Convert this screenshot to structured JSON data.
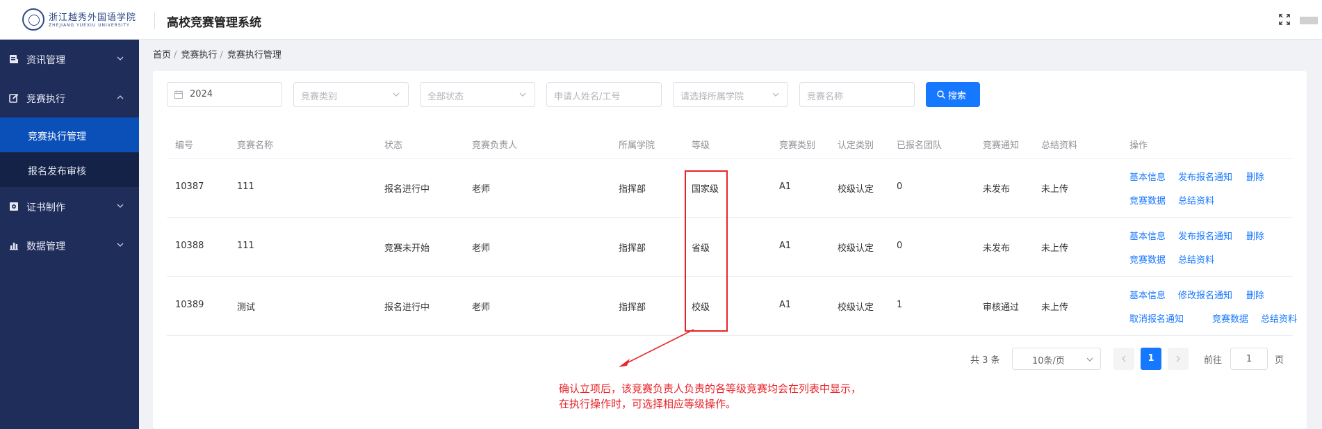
{
  "header": {
    "logo_text": "浙江越秀外国语学院",
    "logo_sub": "ZHEJIANG YUEXIU UNIVERSITY",
    "title": "高校竞赛管理系统"
  },
  "sidebar": {
    "items": [
      {
        "label": "资讯管理",
        "icon": "document-icon"
      },
      {
        "label": "竞赛执行",
        "icon": "edit-icon",
        "expanded": true,
        "children": [
          {
            "label": "竞赛执行管理",
            "active": true
          },
          {
            "label": "报名发布审核"
          }
        ]
      },
      {
        "label": "证书制作",
        "icon": "certificate-icon"
      },
      {
        "label": "数据管理",
        "icon": "bar-chart-icon"
      }
    ]
  },
  "breadcrumb": {
    "home": "首页",
    "level1": "竞赛执行",
    "current": "竞赛执行管理",
    "separator": "/"
  },
  "filters": {
    "year": "2024",
    "category_placeholder": "竞赛类别",
    "status_placeholder": "全部状态",
    "applicant_placeholder": "申请人姓名/工号",
    "college_placeholder": "请选择所属学院",
    "name_placeholder": "竞赛名称",
    "search_label": "搜索"
  },
  "table": {
    "columns": [
      "编号",
      "竞赛名称",
      "状态",
      "竞赛负责人",
      "所属学院",
      "等级",
      "竞赛类别",
      "认定类别",
      "已报名团队",
      "竞赛通知",
      "总结资料",
      "操作"
    ],
    "rows": [
      {
        "id": "10387",
        "name": "111",
        "status": "报名进行中",
        "leader": "老师",
        "college": "指挥部",
        "level": "国家级",
        "category": "A1",
        "recognition": "校级认定",
        "teams": "0",
        "notice": "未发布",
        "summary": "未上传",
        "ops": [
          "基本信息",
          "发布报名通知",
          "删除",
          "竞赛数据",
          "总结资料"
        ]
      },
      {
        "id": "10388",
        "name": "111",
        "status": "竞赛未开始",
        "leader": "老师",
        "college": "指挥部",
        "level": "省级",
        "category": "A1",
        "recognition": "校级认定",
        "teams": "0",
        "notice": "未发布",
        "summary": "未上传",
        "ops": [
          "基本信息",
          "发布报名通知",
          "删除",
          "竞赛数据",
          "总结资料"
        ]
      },
      {
        "id": "10389",
        "name": "测试",
        "status": "报名进行中",
        "leader": "老师",
        "college": "指挥部",
        "level": "校级",
        "category": "A1",
        "recognition": "校级认定",
        "teams": "1",
        "notice": "审核通过",
        "summary": "未上传",
        "ops": [
          "基本信息",
          "修改报名通知",
          "删除",
          "取消报名通知",
          "竞赛数据",
          "总结资料"
        ]
      }
    ]
  },
  "pagination": {
    "total_text": "共 3 条",
    "page_size": "10条/页",
    "current_page": "1",
    "goto_label": "前往",
    "goto_value": "1",
    "page_word": "页"
  },
  "annotation": {
    "line1": "确认立项后，该竞赛负责人负责的各等级竞赛均会在列表中显示，",
    "line2": "在执行操作时，可选择相应等级操作。",
    "color": "#e8242a"
  },
  "colors": {
    "sidebar_bg": "#1f2d5a",
    "active_item": "#0b4fb8",
    "primary": "#1677ff"
  }
}
